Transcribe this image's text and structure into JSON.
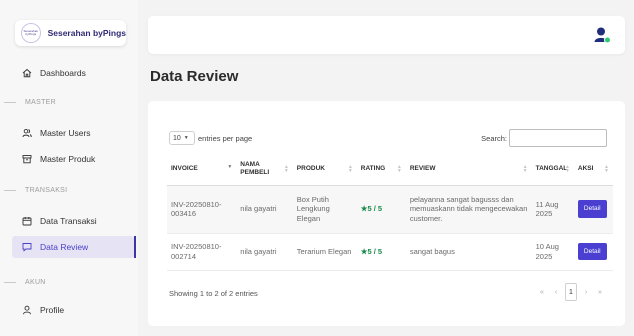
{
  "brand": {
    "logo_text": "Seserahan byPings",
    "name": "Seserahan byPings"
  },
  "sidebar": {
    "items": [
      {
        "label": "Dashboards",
        "icon": "home-icon"
      },
      {
        "label": "Master Users",
        "icon": "users-icon"
      },
      {
        "label": "Master Produk",
        "icon": "box-icon"
      },
      {
        "label": "Data Transaksi",
        "icon": "calendar-icon"
      },
      {
        "label": "Data Review",
        "icon": "chat-icon",
        "active": true
      },
      {
        "label": "Profile",
        "icon": "user-icon"
      }
    ],
    "sections": [
      "MASTER",
      "TRANSAKSI",
      "AKUN"
    ]
  },
  "page": {
    "title": "Data Review"
  },
  "controls": {
    "length_value": "10",
    "length_suffix": "entries per page",
    "search_label": "Search:"
  },
  "table": {
    "headers": [
      "INVOICE",
      "NAMA PEMBELI",
      "PRODUK",
      "RATING",
      "REVIEW",
      "TANGGAL",
      "AKSI"
    ],
    "rows": [
      {
        "invoice": "INV-20250810-003416",
        "buyer": "nila gayatri",
        "product": "Box Putih Lengkung Elegan",
        "rating": "5 / 5",
        "review": "pelayanna sangat bagusss dan memuaskann tidak mengecewakan customer.",
        "date": "11 Aug 2025",
        "action": "Detail"
      },
      {
        "invoice": "INV-20250810-002714",
        "buyer": "nila gayatri",
        "product": "Terarium Elegan",
        "rating": "5 / 5",
        "review": "sangat bagus",
        "date": "10 Aug 2025",
        "action": "Detail"
      }
    ]
  },
  "footer": {
    "info": "Showing 1 to 2 of 2 entries",
    "pager": {
      "first": "«",
      "prev": "‹",
      "current": "1",
      "next": "›",
      "last": "»"
    }
  },
  "colors": {
    "accent": "#4a3fd1",
    "active_bg": "#e6e3f5",
    "rating": "#1a8a4a"
  }
}
